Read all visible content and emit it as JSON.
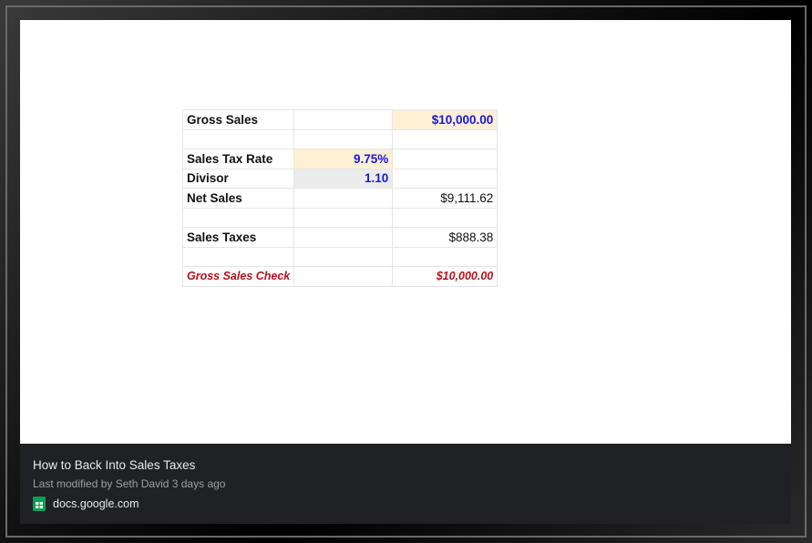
{
  "sheet": {
    "rows": [
      {
        "label": "Gross Sales",
        "col2": "",
        "col3": "$10,000.00"
      },
      {
        "label": "",
        "col2": "",
        "col3": ""
      },
      {
        "label": "Sales Tax Rate",
        "col2": "9.75%",
        "col3": ""
      },
      {
        "label": "Divisor",
        "col2": "1.10",
        "col3": ""
      },
      {
        "label": "Net Sales",
        "col2": "",
        "col3": "$9,111.62"
      },
      {
        "label": "",
        "col2": "",
        "col3": ""
      },
      {
        "label": "Sales Taxes",
        "col2": "",
        "col3": "$888.38"
      },
      {
        "label": "",
        "col2": "",
        "col3": ""
      },
      {
        "label": "Gross Sales Check",
        "col2": "",
        "col3": "$10,000.00"
      }
    ]
  },
  "footer": {
    "title": "How to Back Into Sales Taxes",
    "subtitle": "Last modified by Seth David 3 days ago",
    "source": "docs.google.com",
    "source_icon": "google-sheets-icon"
  },
  "colors": {
    "input_blue": "#1a18e0",
    "check_red": "#b5121b",
    "input_fill": "#fdf0d3",
    "footer_bg": "#202124"
  }
}
